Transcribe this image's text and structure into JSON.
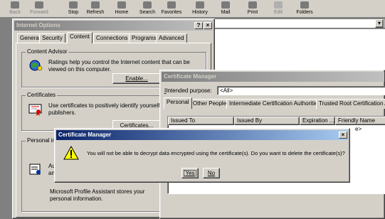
{
  "toolbar": {
    "buttons": [
      {
        "label": "Back",
        "icon": "back-arrow-icon"
      },
      {
        "label": "Forward",
        "icon": "forward-arrow-icon"
      },
      {
        "label": "Stop",
        "icon": "stop-icon"
      },
      {
        "label": "Refresh",
        "icon": "refresh-icon"
      },
      {
        "label": "Home",
        "icon": "home-icon"
      },
      {
        "label": "Search",
        "icon": "search-icon"
      },
      {
        "label": "Favorites",
        "icon": "favorites-icon"
      },
      {
        "label": "History",
        "icon": "history-icon"
      },
      {
        "label": "Mail",
        "icon": "mail-icon"
      },
      {
        "label": "Print",
        "icon": "print-icon"
      },
      {
        "label": "Edit",
        "icon": "edit-icon"
      },
      {
        "label": "Folders",
        "icon": "folders-icon"
      }
    ]
  },
  "internet_options": {
    "title": "Internet Options",
    "help_btn": "?",
    "close_btn": "×",
    "tabs": [
      "General",
      "Security",
      "Content",
      "Connections",
      "Programs",
      "Advanced"
    ],
    "selected_tab": "Content",
    "content_advisor": {
      "group": "Content Advisor",
      "text": "Ratings help you control the Internet content that can be viewed on this computer.",
      "enable_button": "Enable..."
    },
    "certificates": {
      "group": "Certificates",
      "text": "Use certificates to positively identify yourself, authorities, and publishers.",
      "certificates_button": "Certificates..."
    },
    "personal": {
      "group": "Personal in",
      "text_partial": "Au an",
      "assistant_text": "Microsoft Profile Assistant stores your personal information."
    }
  },
  "certificate_manager": {
    "title": "Certificate Manager",
    "intended_purpose_label": "Intended purpose:",
    "intended_purpose_value": "<All>",
    "tabs": [
      "Personal",
      "Other People",
      "Intermediate Certification Authorities",
      "Trusted Root Certification Au"
    ],
    "columns": [
      "Issued To",
      "Issued By",
      "Expiration ...",
      "Friendly Name"
    ],
    "row_fragment": "e>"
  },
  "confirm_dialog": {
    "title": "Certificate Manager",
    "close_btn": "×",
    "message": "You will not be able to decrypt data encrypted using the certificate(s). Do you want to delete the certificate(s)?",
    "yes_button": "Yes",
    "no_button": "No"
  }
}
